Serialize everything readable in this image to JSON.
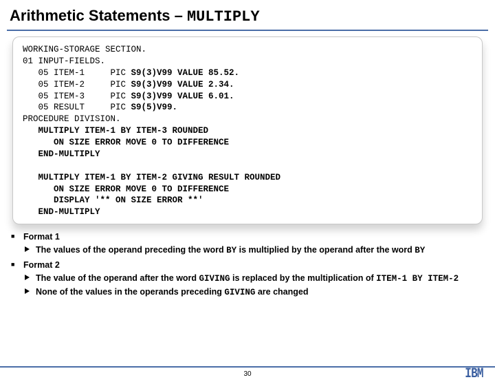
{
  "title": {
    "prefix": "Arithmetic Statements – ",
    "keyword": "MULTIPLY"
  },
  "code": {
    "l1": "WORKING-STORAGE SECTION.",
    "l2": "01 INPUT-FIELDS.",
    "l3a": "   05 ITEM-1     PIC ",
    "l3b": "S9(3)V99 VALUE 85.52.",
    "l4a": "   05 ITEM-2     PIC ",
    "l4b": "S9(3)V99 VALUE 2.34.",
    "l5a": "   05 ITEM-3     PIC ",
    "l5b": "S9(3)V99 VALUE 6.01.",
    "l6a": "   05 RESULT     PIC ",
    "l6b": "S9(5)V99.",
    "l7": "PROCEDURE DIVISION.",
    "l8": "   MULTIPLY ITEM-1 BY ITEM-3 ROUNDED",
    "l9": "      ON SIZE ERROR MOVE 0 TO DIFFERENCE",
    "l10": "   END-MULTIPLY",
    "blank": " ",
    "l11": "   MULTIPLY ITEM-1 BY ITEM-2 GIVING RESULT ROUNDED",
    "l12": "      ON SIZE ERROR MOVE 0 TO DIFFERENCE",
    "l13": "      DISPLAY '** ON SIZE ERROR **'",
    "l14": "   END-MULTIPLY"
  },
  "notes": {
    "f1": "Format 1",
    "f1a_pre": "The values of the operand preceding the word ",
    "f1a_kw1": "BY",
    "f1a_mid": " is multiplied by the operand after the word ",
    "f1a_kw2": "BY",
    "f2": "Format 2",
    "f2a_pre": "The value of the operand after the word ",
    "f2a_kw1": "GIVING",
    "f2a_mid": " is replaced by the multiplication of ",
    "f2a_kw2": "ITEM-1 BY ITEM-2",
    "f2b_pre": "None of the values in the operands preceding ",
    "f2b_kw": "GIVING",
    "f2b_post": " are changed"
  },
  "footer": {
    "page": "30",
    "logo": "IBM"
  }
}
